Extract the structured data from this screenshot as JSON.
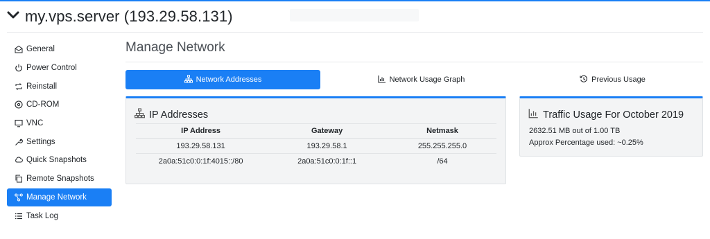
{
  "header": {
    "server_title": "my.vps.server (193.29.58.131)"
  },
  "sidebar": {
    "items": [
      {
        "label": "General",
        "icon": "envelope-open-icon"
      },
      {
        "label": "Power Control",
        "icon": "power-icon"
      },
      {
        "label": "Reinstall",
        "icon": "refresh-arrows-icon"
      },
      {
        "label": "CD-ROM",
        "icon": "disc-icon"
      },
      {
        "label": "VNC",
        "icon": "monitor-icon"
      },
      {
        "label": "Settings",
        "icon": "wrench-icon"
      },
      {
        "label": "Quick Snapshots",
        "icon": "cloud-arrows-icon"
      },
      {
        "label": "Remote Snapshots",
        "icon": "copy-icon"
      },
      {
        "label": "Manage Network",
        "icon": "network-icon"
      },
      {
        "label": "Task Log",
        "icon": "list-icon"
      }
    ],
    "active_index": 8
  },
  "main": {
    "page_title": "Manage Network",
    "tabs": [
      {
        "label": "Network Addresses",
        "icon": "sitemap-icon"
      },
      {
        "label": "Network Usage Graph",
        "icon": "bar-chart-icon"
      },
      {
        "label": "Previous Usage",
        "icon": "history-icon"
      }
    ],
    "active_tab": 0
  },
  "ip_panel": {
    "title": "IP Addresses",
    "columns": [
      "IP Address",
      "Gateway",
      "Netmask"
    ],
    "rows": [
      [
        "193.29.58.131",
        "193.29.58.1",
        "255.255.255.0"
      ],
      [
        "2a0a:51c0:0:1f:4015::/80",
        "2a0a:51c0:0:1f::1",
        "/64"
      ]
    ]
  },
  "traffic_panel": {
    "title": "Traffic Usage For October 2019",
    "usage_line": "2632.51 MB out of 1.00 TB",
    "percent_line": "Approx Percentage used: ~0.25%"
  },
  "colors": {
    "accent": "#1a7ff5",
    "panel_bg": "#f3f4f5"
  }
}
